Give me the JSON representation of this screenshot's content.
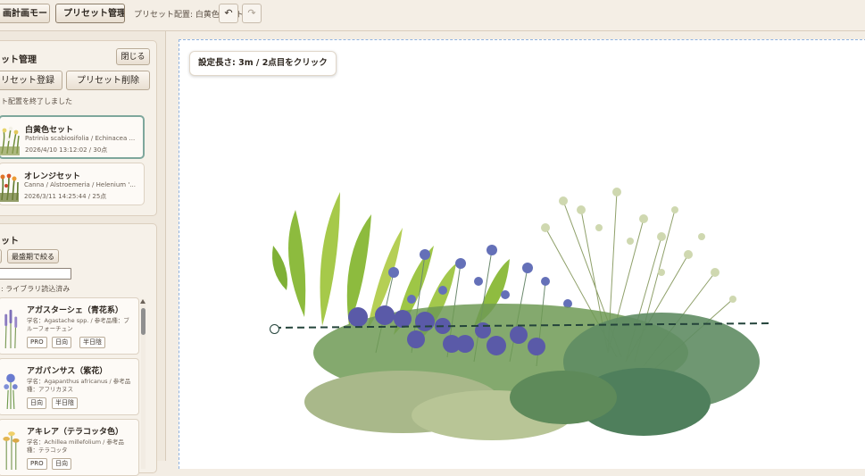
{
  "toolbar": {
    "mode_button": "画計画モード",
    "preset_manage_button": "プリセット管理",
    "preset_placement_label": "プリセット配置: 白黄色セット",
    "undo_icon": "↶",
    "redo_icon": "↷"
  },
  "preset_panel": {
    "title": "ット管理",
    "close_button": "閉じる",
    "register_button": "リセット登録",
    "delete_button": "プリセット削除",
    "status": "ト配置を終了しました",
    "items": [
      {
        "name": "白黄色セット",
        "plants": "Patrinia scabiosifolia / Echinacea ...",
        "meta": "2026/4/10 13:12:02 / 30点"
      },
      {
        "name": "オレンジセット",
        "plants": "Canna / Alstroemeria / Helenium '...",
        "meta": "2026/3/11 14:25:44 / 25点"
      }
    ]
  },
  "plant_panel": {
    "title": "ット",
    "filter_button": "最盛期で絞る",
    "search_placeholder": "",
    "status": ": ライブラリ読込済み",
    "plants": [
      {
        "name": "アガスターシェ（青花系）",
        "desc": "学名：Agastache spp. / 参考品種：ブルーフォーチュン",
        "tags": [
          "PRO",
          "日向",
          "半日陰"
        ]
      },
      {
        "name": "アガパンサス（紫花）",
        "desc": "学名：Agapanthus africanus / 参考品種：アフリカヌス",
        "tags": [
          "日向",
          "半日陰"
        ]
      },
      {
        "name": "アキレア（テラコッタ色）",
        "desc": "学名：Achillea millefolium / 参考品種：テラコッタ",
        "tags": [
          "PRO",
          "日向"
        ]
      }
    ]
  },
  "canvas": {
    "hint": "設定長さ: 3m / 2点目をクリック"
  }
}
